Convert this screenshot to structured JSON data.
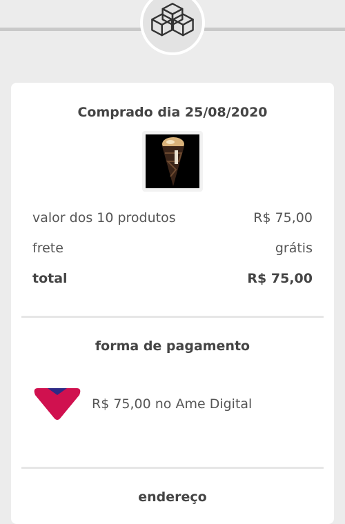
{
  "header": {
    "icon": "boxes-icon"
  },
  "order": {
    "purchase_date_text": "Comprado dia 25/08/2020",
    "product_image_icon": "ice-cream-cone-icon"
  },
  "summary": {
    "items_label": "valor dos 10 produtos",
    "items_value": "R$ 75,00",
    "shipping_label": "frete",
    "shipping_value": "grátis",
    "total_label": "total",
    "total_value": "R$ 75,00"
  },
  "payment": {
    "title": "forma de pagamento",
    "method_text": "R$ 75,00 no Ame Digital",
    "logo_icon": "ame-digital-logo-icon",
    "logo_colors": {
      "main": "#d0114f",
      "top": "#2e2a86"
    }
  },
  "address": {
    "title": "endereço"
  }
}
